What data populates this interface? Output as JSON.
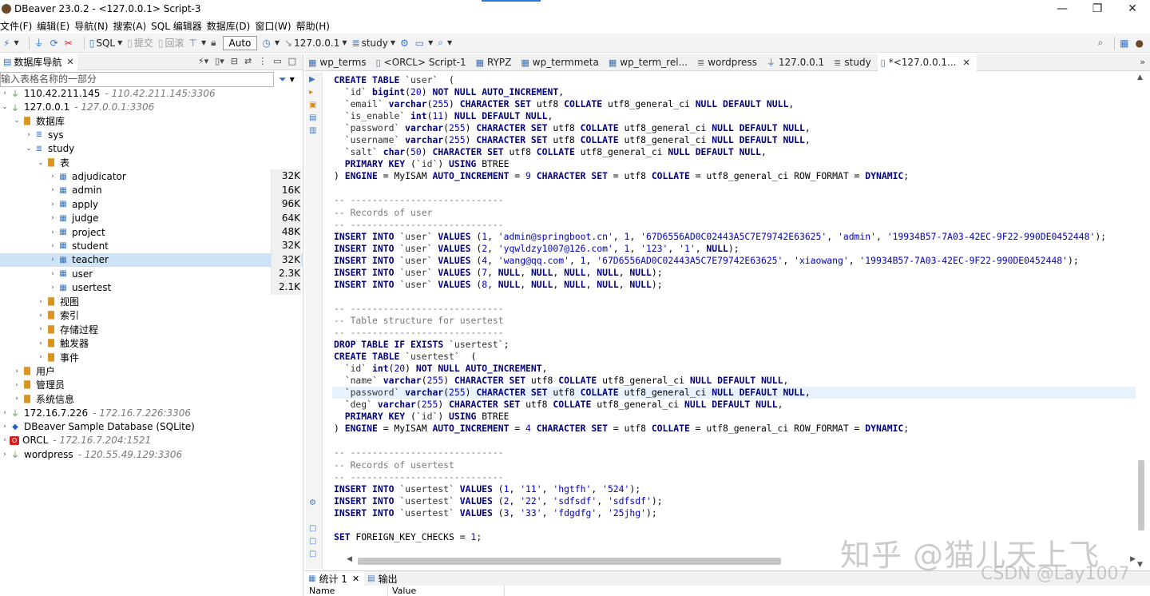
{
  "window": {
    "title": "DBeaver 23.0.2 - <127.0.0.1> Script-3",
    "controls": [
      "—",
      "❐",
      "✕"
    ]
  },
  "menu": [
    "文件(F)",
    "编辑(E)",
    "导航(N)",
    "搜索(A)",
    "SQL 编辑器",
    "数据库(D)",
    "窗口(W)",
    "帮助(H)"
  ],
  "toolbar": {
    "sql_label": "SQL",
    "commit_label": "提交",
    "rollback_label": "回滚",
    "auto_label": "Auto",
    "connection_label": "127.0.0.1",
    "schema_label": "study"
  },
  "navigator": {
    "tab_label": "数据库导航",
    "filter_placeholder": "输入表格名称的一部分",
    "rows": [
      {
        "depth": 0,
        "toggle": "›",
        "icon": "conn",
        "label": "110.42.211.145",
        "sub": "- 110.42.211.145:3306"
      },
      {
        "depth": 0,
        "toggle": "⌄",
        "icon": "conn",
        "label": "127.0.0.1",
        "sub": "- 127.0.0.1:3306"
      },
      {
        "depth": 1,
        "toggle": "⌄",
        "icon": "folder",
        "label": "数据库"
      },
      {
        "depth": 2,
        "toggle": "›",
        "icon": "db",
        "label": "sys"
      },
      {
        "depth": 2,
        "toggle": "⌄",
        "icon": "db",
        "label": "study"
      },
      {
        "depth": 3,
        "toggle": "⌄",
        "icon": "folder",
        "label": "表"
      },
      {
        "depth": 4,
        "toggle": "›",
        "icon": "table",
        "label": "adjudicator",
        "size": "32K"
      },
      {
        "depth": 4,
        "toggle": "›",
        "icon": "table",
        "label": "admin",
        "size": "16K"
      },
      {
        "depth": 4,
        "toggle": "›",
        "icon": "table",
        "label": "apply",
        "size": "96K"
      },
      {
        "depth": 4,
        "toggle": "›",
        "icon": "table",
        "label": "judge",
        "size": "64K"
      },
      {
        "depth": 4,
        "toggle": "›",
        "icon": "table",
        "label": "project",
        "size": "48K"
      },
      {
        "depth": 4,
        "toggle": "›",
        "icon": "table",
        "label": "student",
        "size": "32K"
      },
      {
        "depth": 4,
        "toggle": "›",
        "icon": "table",
        "label": "teacher",
        "size": "32K",
        "selected": true
      },
      {
        "depth": 4,
        "toggle": "›",
        "icon": "table",
        "label": "user",
        "size": "2.3K"
      },
      {
        "depth": 4,
        "toggle": "›",
        "icon": "table",
        "label": "usertest",
        "size": "2.1K"
      },
      {
        "depth": 3,
        "toggle": "›",
        "icon": "folder",
        "label": "视图"
      },
      {
        "depth": 3,
        "toggle": "›",
        "icon": "folder",
        "label": "索引"
      },
      {
        "depth": 3,
        "toggle": "›",
        "icon": "folder",
        "label": "存储过程"
      },
      {
        "depth": 3,
        "toggle": "›",
        "icon": "folder",
        "label": "触发器"
      },
      {
        "depth": 3,
        "toggle": "›",
        "icon": "folder",
        "label": "事件"
      },
      {
        "depth": 1,
        "toggle": "›",
        "icon": "folder",
        "label": "用户"
      },
      {
        "depth": 1,
        "toggle": "›",
        "icon": "folder",
        "label": "管理员"
      },
      {
        "depth": 1,
        "toggle": "›",
        "icon": "folder",
        "label": "系统信息"
      },
      {
        "depth": 0,
        "toggle": "›",
        "icon": "conn",
        "label": "172.16.7.226",
        "sub": "- 172.16.7.226:3306"
      },
      {
        "depth": 0,
        "toggle": "›",
        "icon": "sqlite",
        "label": "DBeaver Sample Database (SQLite)"
      },
      {
        "depth": 0,
        "toggle": "›",
        "icon": "orcl",
        "label": "ORCL",
        "sub": "- 172.16.7.204:1521"
      },
      {
        "depth": 0,
        "toggle": "›",
        "icon": "conn",
        "label": "wordpress",
        "sub": "- 120.55.49.129:3306"
      }
    ]
  },
  "editor_tabs": [
    {
      "label": "wp_terms",
      "icon": "table"
    },
    {
      "label": "<ORCL> Script-1",
      "icon": "script"
    },
    {
      "label": "RYPZ",
      "icon": "table"
    },
    {
      "label": "wp_termmeta",
      "icon": "table"
    },
    {
      "label": "wp_term_rel...",
      "icon": "table"
    },
    {
      "label": "wordpress",
      "icon": "db"
    },
    {
      "label": "127.0.0.1",
      "icon": "conn"
    },
    {
      "label": "study",
      "icon": "db"
    },
    {
      "label": "*<127.0.0.1...",
      "icon": "script",
      "active": true
    }
  ],
  "code_lines": [
    "CREATE TABLE `user`  (",
    "  `id` bigint(20) NOT NULL AUTO_INCREMENT,",
    "  `email` varchar(255) CHARACTER SET utf8 COLLATE utf8_general_ci NULL DEFAULT NULL,",
    "  `is_enable` int(11) NULL DEFAULT NULL,",
    "  `password` varchar(255) CHARACTER SET utf8 COLLATE utf8_general_ci NULL DEFAULT NULL,",
    "  `username` varchar(255) CHARACTER SET utf8 COLLATE utf8_general_ci NULL DEFAULT NULL,",
    "  `salt` char(50) CHARACTER SET utf8 COLLATE utf8_general_ci NULL DEFAULT NULL,",
    "  PRIMARY KEY (`id`) USING BTREE",
    ") ENGINE = MyISAM AUTO_INCREMENT = 9 CHARACTER SET = utf8 COLLATE = utf8_general_ci ROW_FORMAT = DYNAMIC;",
    "",
    "-- ----------------------------",
    "-- Records of user",
    "-- ----------------------------",
    "INSERT INTO `user` VALUES (1, 'admin@springboot.cn', 1, '67D6556AD0C02443A5C7E79742E63625', 'admin', '19934B57-7A03-42EC-9F22-990DE0452448');",
    "INSERT INTO `user` VALUES (2, 'yqwldzy1007@126.com', 1, '123', '1', NULL);",
    "INSERT INTO `user` VALUES (4, 'wang@qq.com', 1, '67D6556AD0C02443A5C7E79742E63625', 'xiaowang', '19934B57-7A03-42EC-9F22-990DE0452448');",
    "INSERT INTO `user` VALUES (7, NULL, NULL, NULL, NULL, NULL);",
    "INSERT INTO `user` VALUES (8, NULL, NULL, NULL, NULL, NULL);",
    "",
    "-- ----------------------------",
    "-- Table structure for usertest",
    "-- ----------------------------",
    "DROP TABLE IF EXISTS `usertest`;",
    "CREATE TABLE `usertest`  (",
    "  `id` int(20) NOT NULL AUTO_INCREMENT,",
    "  `name` varchar(255) CHARACTER SET utf8 COLLATE utf8_general_ci NULL DEFAULT NULL,",
    "  `password` varchar(255) CHARACTER SET utf8 COLLATE utf8_general_ci NULL DEFAULT NULL,",
    "  `deg` varchar(255) CHARACTER SET utf8 COLLATE utf8_general_ci NULL DEFAULT NULL,",
    "  PRIMARY KEY (`id`) USING BTREE",
    ") ENGINE = MyISAM AUTO_INCREMENT = 4 CHARACTER SET = utf8 COLLATE = utf8_general_ci ROW_FORMAT = DYNAMIC;",
    "",
    "-- ----------------------------",
    "-- Records of usertest",
    "-- ----------------------------",
    "INSERT INTO `usertest` VALUES (1, '11', 'hgtfh', '524');",
    "INSERT INTO `usertest` VALUES (2, '22', 'sdfsdf', 'sdfsdf');",
    "INSERT INTO `usertest` VALUES (3, '33', 'fdgdfg', '25jhg');",
    "",
    "SET FOREIGN_KEY_CHECKS = 1;"
  ],
  "highlighted_line": 26,
  "bottom_panel": {
    "tabs": [
      {
        "label": "统计 1",
        "active": true
      },
      {
        "label": "输出"
      }
    ],
    "columns": [
      "Name",
      "Value"
    ]
  },
  "watermarks": {
    "zhihu": "知乎 @猫儿天上飞",
    "csdn": "CSDN @Lay1007"
  }
}
